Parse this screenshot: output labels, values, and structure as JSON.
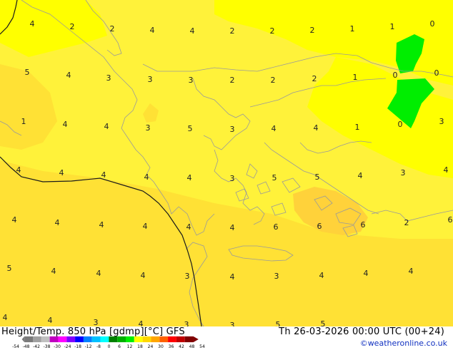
{
  "map": {
    "colors": {
      "bright_yellow": "#FFFF00",
      "mid_yellow": "#FFF23A",
      "warm_yellow": "#FFE135",
      "orange_patch": "#FFD23A",
      "green": "#00EE00",
      "coast": "#9a9a9a",
      "boundary": "#1a1a1a"
    },
    "labels": [
      "4",
      "2",
      "2",
      "4",
      "4",
      "2",
      "2",
      "2",
      "1",
      "1",
      "0",
      "5",
      "4",
      "3",
      "3",
      "3",
      "2",
      "2",
      "2",
      "1",
      "0",
      "0",
      "1",
      "4",
      "4",
      "3",
      "5",
      "3",
      "4",
      "4",
      "1",
      "0",
      "3",
      "4",
      "4",
      "4",
      "4",
      "4",
      "3",
      "5",
      "5",
      "4",
      "3",
      "4",
      "4",
      "4",
      "4",
      "4",
      "4",
      "4",
      "6",
      "6",
      "6",
      "2",
      "6",
      "5",
      "4",
      "4",
      "4",
      "3",
      "4",
      "3",
      "4",
      "4",
      "4",
      "4",
      "4",
      "3",
      "4",
      "3",
      "3",
      "5",
      "5"
    ]
  },
  "footer": {
    "left_title": "Height/Temp. 850 hPa [gdmp][°C] GFS",
    "right_title": "Th 26-03-2026 00:00 UTC (00+24)",
    "credit": "©weatheronline.co.uk",
    "scale_ticks": [
      "-54",
      "-48",
      "-42",
      "-38",
      "-30",
      "-24",
      "-18",
      "-12",
      "-8",
      "0",
      "6",
      "12",
      "18",
      "24",
      "30",
      "36",
      "42",
      "48",
      "54"
    ],
    "scale_colors": [
      "#7a7a7a",
      "#a0a0a0",
      "#c0c0c0",
      "#c000c0",
      "#ff00ff",
      "#8000ff",
      "#0000ff",
      "#0080ff",
      "#00c0ff",
      "#00ffff",
      "#008000",
      "#00b000",
      "#00ee00",
      "#ffff00",
      "#ffd700",
      "#ffa500",
      "#ff6000",
      "#ff0000",
      "#c00000",
      "#800000"
    ]
  }
}
